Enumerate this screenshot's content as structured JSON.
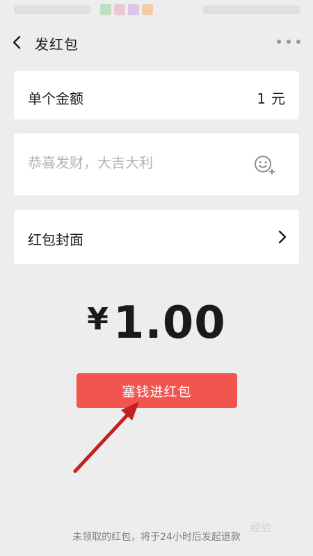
{
  "nav": {
    "title": "发红包",
    "back_icon": "chevron-left-icon",
    "more_icon": "more-dots-icon"
  },
  "amount_row": {
    "label": "单个金额",
    "value": "1",
    "unit": "元"
  },
  "greeting": {
    "placeholder": "恭喜发财，大吉大利",
    "value": "",
    "emoji_icon": "emoji-add-icon"
  },
  "cover_row": {
    "label": "红包封面",
    "chevron_icon": "chevron-right-icon"
  },
  "total": {
    "currency": "¥",
    "amount": "1.00"
  },
  "submit": {
    "label": "塞钱进红包"
  },
  "footer": {
    "note": "未领取的红包，将于24小时后发起退款"
  },
  "colors": {
    "background": "#ededed",
    "card": "#ffffff",
    "accent_red": "#f25450",
    "annotation_arrow": "#c41f1f",
    "placeholder": "#b3b3b3"
  }
}
